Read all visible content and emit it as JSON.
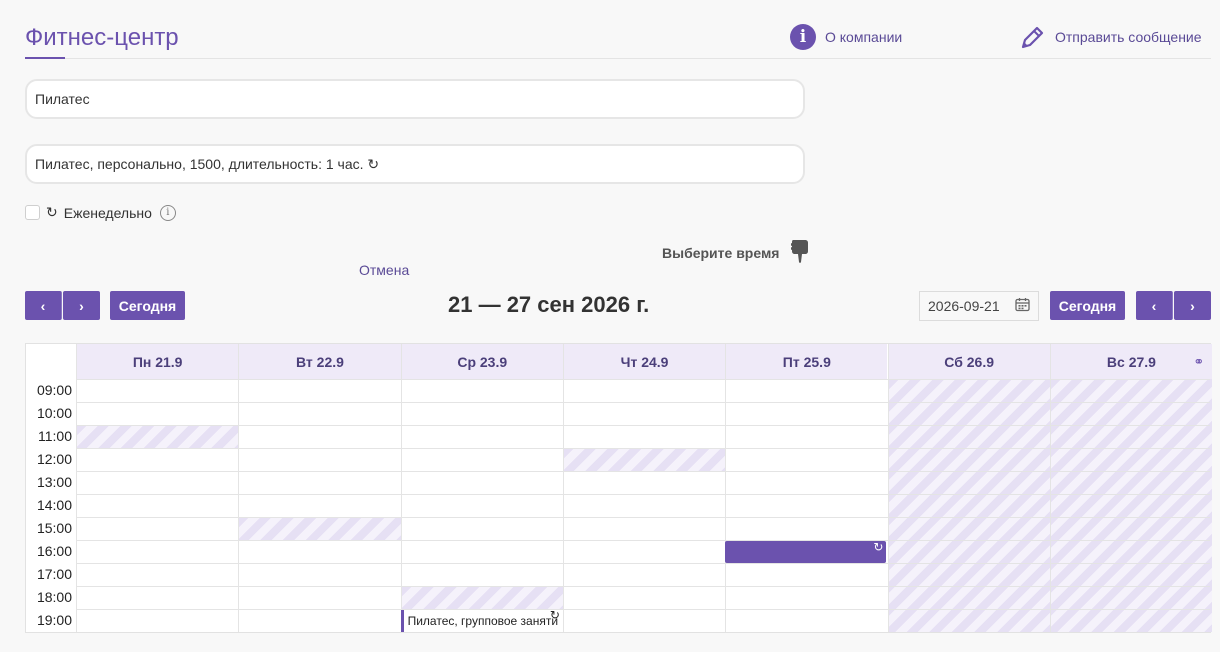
{
  "header": {
    "brand": "Фитнес-центр",
    "about_label": "О компании",
    "message_label": "Отправить сообщение"
  },
  "form": {
    "service_value": "Пилатес",
    "option_value": "Пилатес, персонально, 1500, длительность: 1 час. ↻",
    "weekly_label": "Еженедельно",
    "choose_time_label": "Выберите время",
    "cancel_label": "Отмена"
  },
  "toolbar": {
    "prev_glyph": "‹",
    "next_glyph": "›",
    "today_label": "Сегодня",
    "week_title": "21 — 27 сен 2026 г.",
    "date_value": "2026-09-21"
  },
  "calendar": {
    "days": [
      "Пн 21.9",
      "Вт 22.9",
      "Ср 23.9",
      "Чт 24.9",
      "Пт 25.9",
      "Сб 26.9",
      "Вс 27.9"
    ],
    "hours": [
      "09:00",
      "10:00",
      "11:00",
      "12:00",
      "13:00",
      "14:00",
      "15:00",
      "16:00",
      "17:00",
      "18:00",
      "19:00"
    ],
    "unavailable": [
      {
        "day": 0,
        "hour": "11:00"
      },
      {
        "day": 1,
        "hour": "15:00"
      },
      {
        "day": 3,
        "hour": "12:00"
      },
      {
        "day": 2,
        "hour": "18:00"
      },
      {
        "day": 5,
        "hour": "all"
      },
      {
        "day": 6,
        "hour": "all"
      }
    ],
    "events": [
      {
        "day": 4,
        "hour": "16:00",
        "label": "",
        "repeat_glyph": "↻",
        "style": "solid"
      },
      {
        "day": 2,
        "hour": "19:00",
        "label": "Пилатес, групповое заняти",
        "repeat_glyph": "↻",
        "style": "outline"
      }
    ]
  },
  "colors": {
    "accent": "#6b52ae",
    "header_bg": "#efeaf8"
  }
}
